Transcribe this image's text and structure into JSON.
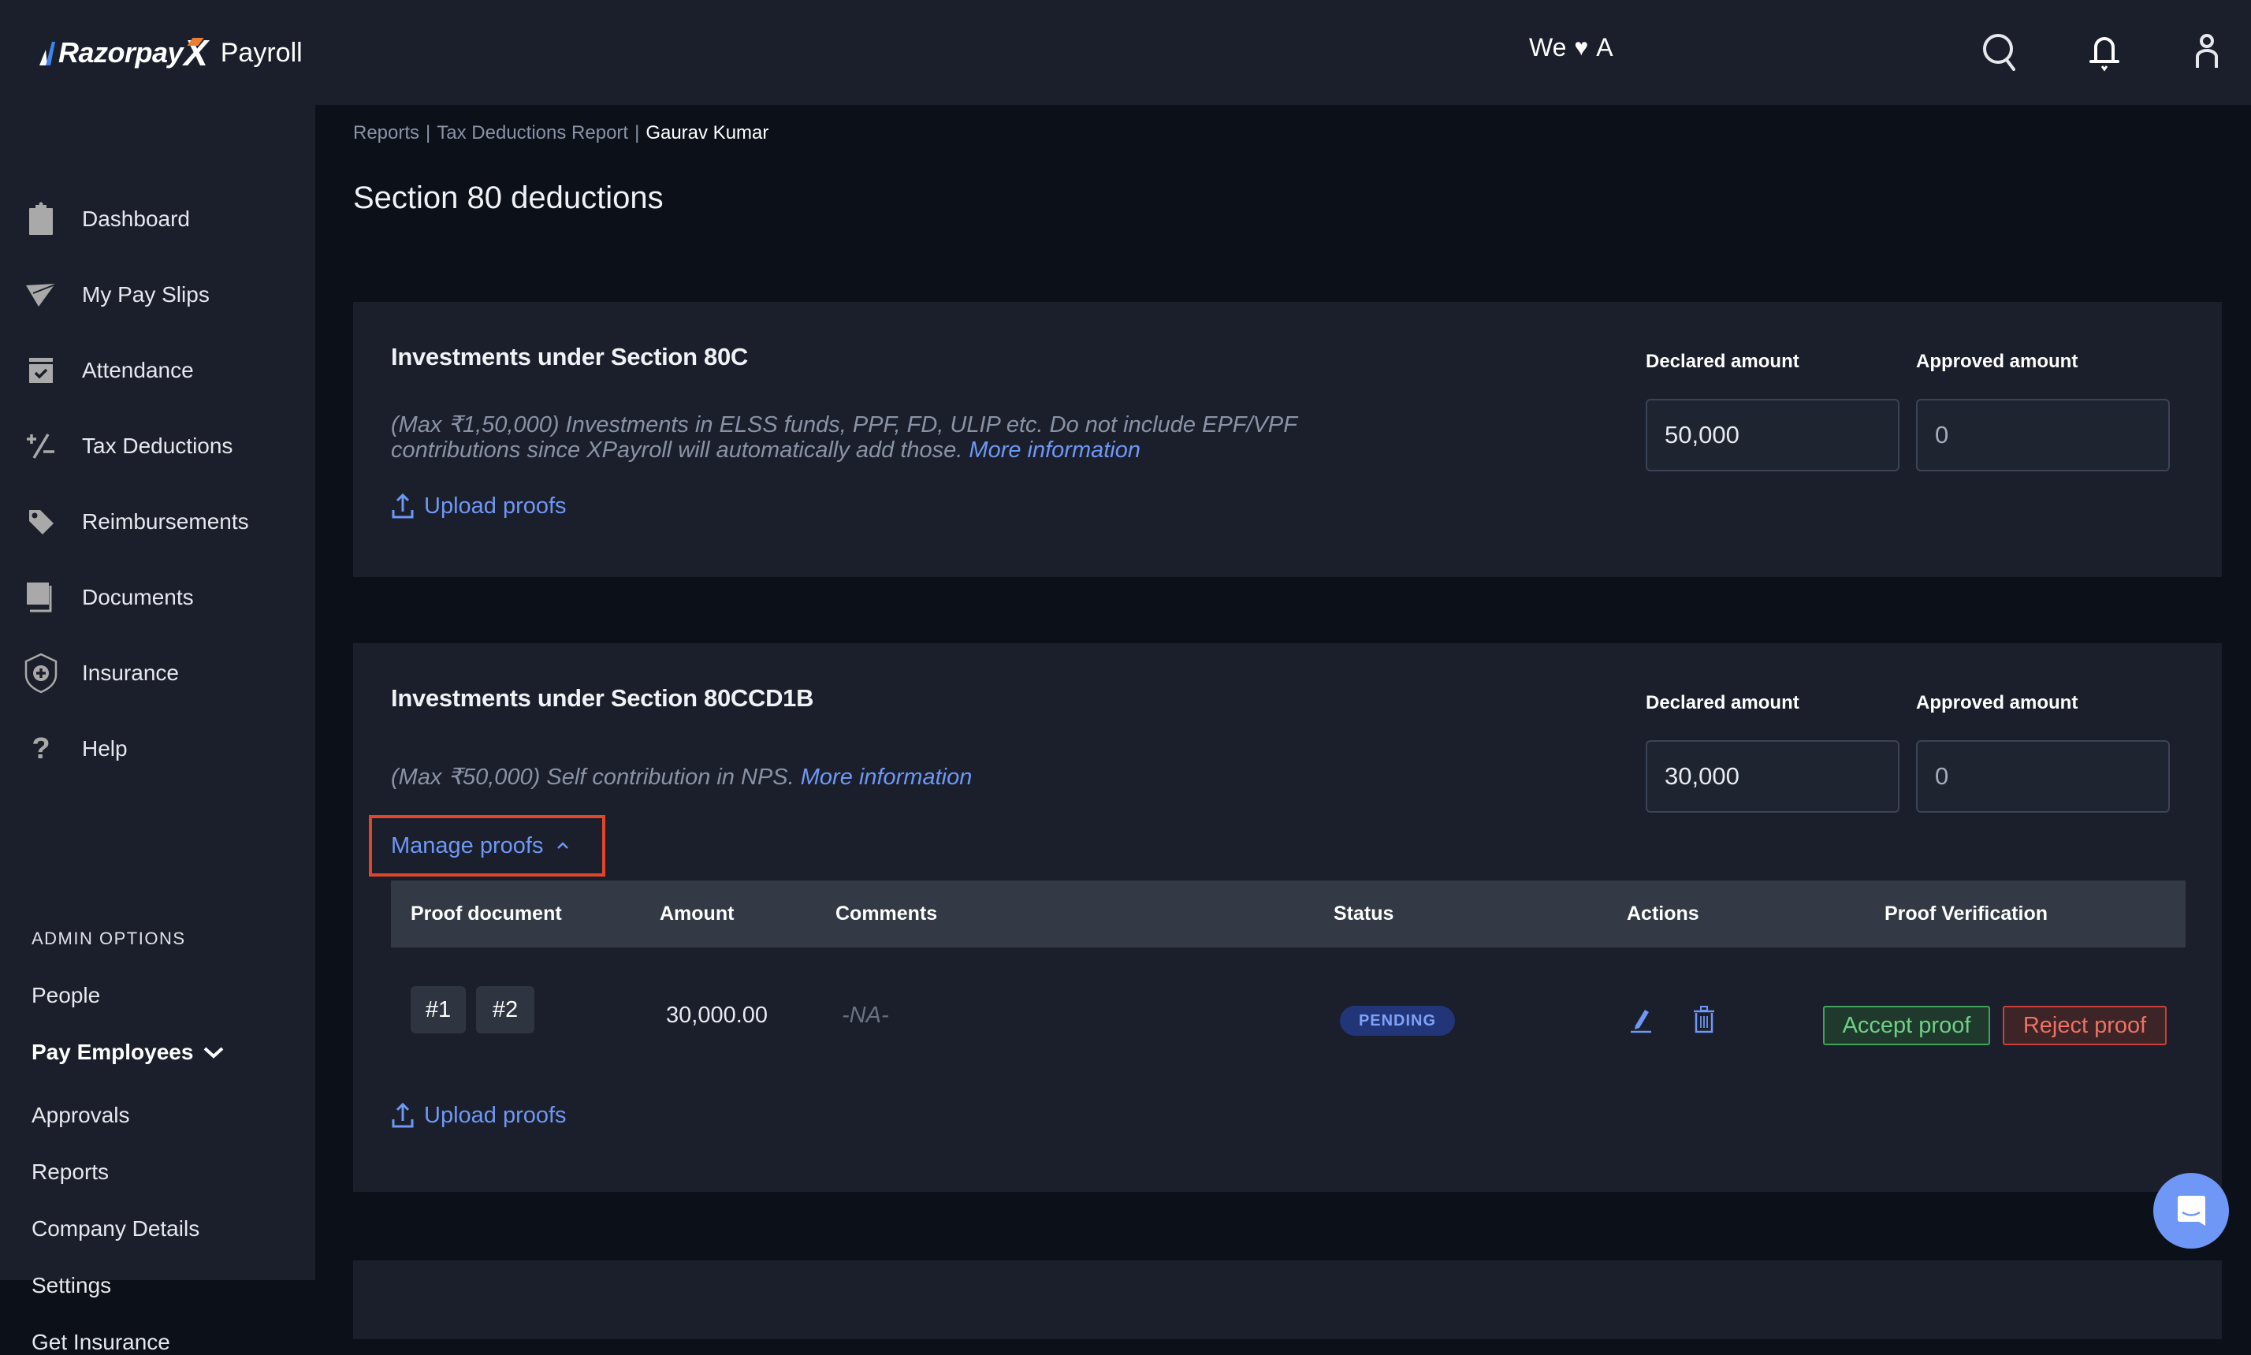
{
  "header": {
    "brand": "Razorpay",
    "brand_x": "X",
    "product": "Payroll",
    "tagline_left": "We",
    "tagline_heart": "♥",
    "tagline_right": "A",
    "icons": [
      "search-icon",
      "bell-icon",
      "user-icon"
    ]
  },
  "sidebar": {
    "items": [
      {
        "label": "Dashboard",
        "icon": "clipboard-icon"
      },
      {
        "label": "My Pay Slips",
        "icon": "paper-plane-icon"
      },
      {
        "label": "Attendance",
        "icon": "calendar-check-icon"
      },
      {
        "label": "Tax Deductions",
        "icon": "plus-minus-icon"
      },
      {
        "label": "Reimbursements",
        "icon": "tag-icon"
      },
      {
        "label": "Documents",
        "icon": "documents-icon"
      },
      {
        "label": "Insurance",
        "icon": "shield-plus-icon"
      },
      {
        "label": "Help",
        "icon": "question-icon"
      }
    ],
    "admin_heading": "ADMIN OPTIONS",
    "admin_items": [
      {
        "label": "People"
      },
      {
        "label": "Pay Employees",
        "expanded": true
      },
      {
        "label": "Approvals"
      },
      {
        "label": "Reports"
      },
      {
        "label": "Company Details"
      },
      {
        "label": "Settings"
      },
      {
        "label": "Get Insurance"
      }
    ]
  },
  "breadcrumb": {
    "items": [
      "Reports",
      "Tax Deductions Report",
      "Gaurav Kumar"
    ],
    "separator": "|"
  },
  "page_title": "Section 80 deductions",
  "sections": [
    {
      "title": "Investments under Section 80C",
      "description": "(Max ₹1,50,000) Investments in ELSS funds, PPF, FD, ULIP etc. Do not include EPF/VPF contributions since XPayroll will automatically add those.",
      "more_info": "More information",
      "declared_label": "Declared amount",
      "approved_label": "Approved amount",
      "declared_value": "50,000",
      "approved_value": "0",
      "upload_label": "Upload proofs"
    },
    {
      "title": "Investments under Section 80CCD1B",
      "description": "(Max ₹50,000) Self contribution in NPS.",
      "more_info": "More information",
      "declared_label": "Declared amount",
      "approved_label": "Approved amount",
      "declared_value": "30,000",
      "approved_value": "0",
      "manage_proofs_label": "Manage proofs",
      "upload_label": "Upload proofs",
      "proofs_table": {
        "columns": [
          "Proof document",
          "Amount",
          "Comments",
          "Status",
          "Actions",
          "Proof Verification"
        ],
        "rows": [
          {
            "documents": [
              "#1",
              "#2"
            ],
            "amount": "30,000.00",
            "comments": "-NA-",
            "status": "PENDING",
            "accept_label": "Accept proof",
            "reject_label": "Reject proof"
          }
        ]
      }
    }
  ],
  "colors": {
    "accent": "#6f97f5",
    "highlight_border": "#e0472a",
    "accept": "#6fcf86",
    "reject": "#ef7163",
    "pending_bg": "#223578"
  }
}
